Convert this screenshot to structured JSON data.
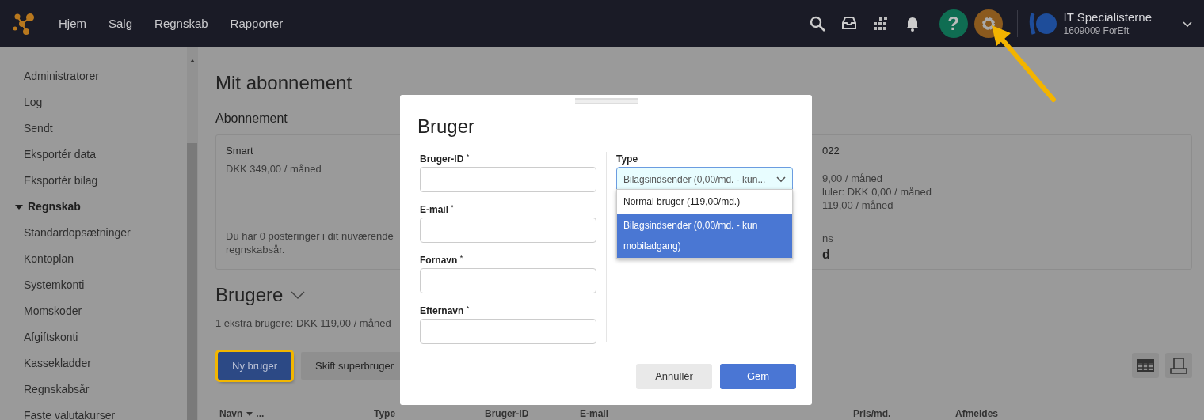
{
  "nav": {
    "links": [
      {
        "label": "Hjem"
      },
      {
        "label": "Salg"
      },
      {
        "label": "Regnskab"
      },
      {
        "label": "Rapporter"
      }
    ],
    "help": "?",
    "account": {
      "company": "IT Specialisterne",
      "subtitle": "1609009 ForEft"
    }
  },
  "sidebar": {
    "items": [
      {
        "label": "Administratorer"
      },
      {
        "label": "Log"
      },
      {
        "label": "Sendt"
      },
      {
        "label": "Eksportér data"
      },
      {
        "label": "Eksportér bilag"
      },
      {
        "label": "Regnskab",
        "expanded": true,
        "children": [
          {
            "label": "Standardopsætninger"
          },
          {
            "label": "Kontoplan"
          },
          {
            "label": "Systemkonti"
          },
          {
            "label": "Momskoder"
          },
          {
            "label": "Afgiftskonti"
          },
          {
            "label": "Kassekladder"
          },
          {
            "label": "Regnskabsår"
          },
          {
            "label": "Faste valutakurser"
          }
        ]
      }
    ]
  },
  "page": {
    "title": "Mit abonnement",
    "subscription": {
      "heading": "Abonnement",
      "plan": "Smart",
      "price": "DKK 349,00 / måned",
      "note": "Du har 0 posteringer i dit nuværende regnskabsår.",
      "right": {
        "title": "022",
        "lines": [
          "9,00 / måned",
          "luler: DKK 0,00 / måned",
          "119,00 / måned"
        ],
        "label": "ns",
        "value": "d"
      }
    }
  },
  "users": {
    "heading": "Brugere",
    "summary": "1 ekstra brugere: DKK 119,00 / måned",
    "buttons": [
      {
        "label": "Ny bruger",
        "kind": "primary",
        "highlighted": true
      },
      {
        "label": "Skift superbruger",
        "kind": "secondary",
        "highlighted": false
      }
    ],
    "columns": [
      {
        "label": "Navn",
        "sorted": true,
        "suffix": "..."
      },
      {
        "label": "Type",
        "sorted": false
      },
      {
        "label": "Bruger-ID",
        "sorted": false
      },
      {
        "label": "E-mail",
        "sorted": false
      },
      {
        "label": "Pris/md.",
        "sorted": false
      },
      {
        "label": "Afmeldes",
        "sorted": false
      }
    ]
  },
  "dialog": {
    "title": "Bruger",
    "fields": [
      {
        "label": "Bruger-ID $^{*}$"
      },
      {
        "label": "E-mail $^{*}$"
      },
      {
        "label": "Fornavn $^{*}$"
      },
      {
        "label": "Efternavn $^{*}$"
      }
    ],
    "type_field": {
      "label": "Type",
      "value": "Bilagsindsender (0,00/md. - kun...",
      "expanded": true,
      "options": [
        {
          "label": "Normal bruger (119,00/md.)",
          "selected": false
        },
        {
          "label": "Bilagsindsender (0,00/md. - kun mobiladgang)",
          "selected": true
        }
      ]
    },
    "buttons": [
      {
        "label": "Annullér",
        "kind": "secondary"
      },
      {
        "label": "Gem",
        "kind": "primary"
      }
    ]
  }
}
